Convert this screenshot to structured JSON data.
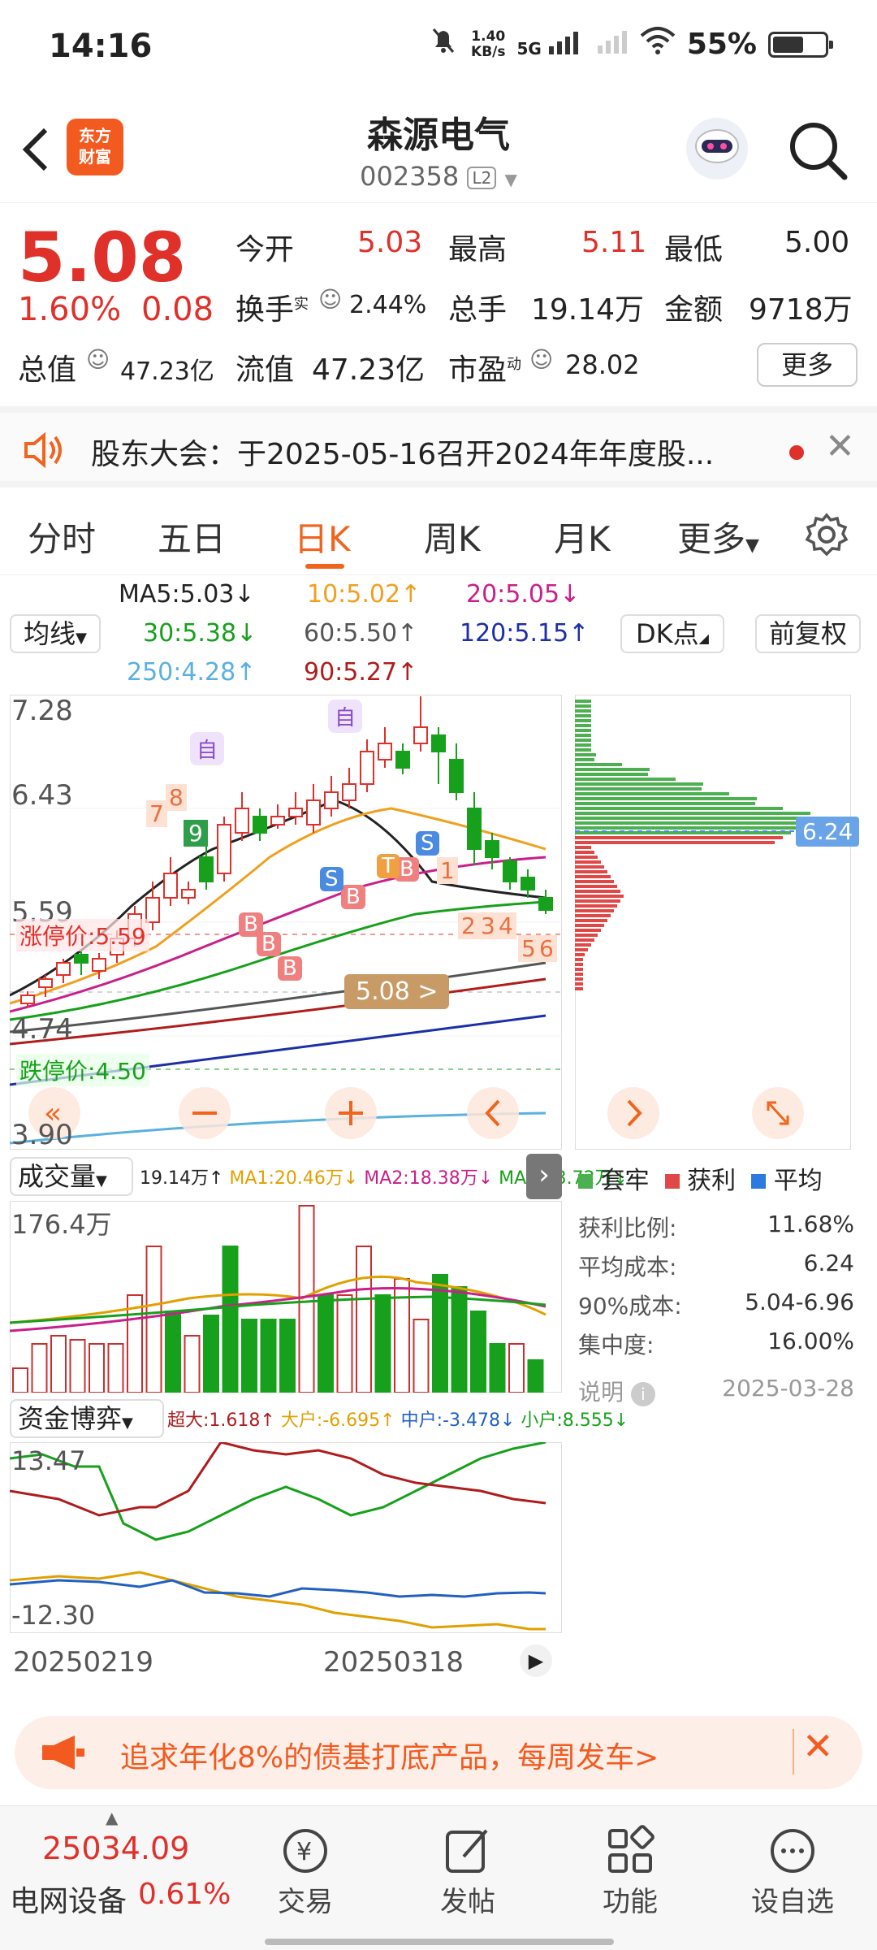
{
  "status": {
    "time": "14:16",
    "speed_value": "1.40",
    "speed_unit": "KB/s",
    "network": "5G",
    "battery": "55%"
  },
  "header": {
    "logo_line1": "东方",
    "logo_line2": "财富",
    "name": "森源电气",
    "code": "002358",
    "level": "L2"
  },
  "quote": {
    "price": "5.08",
    "change_pct": "1.60%",
    "change": "0.08",
    "open_label": "今开",
    "open": "5.03",
    "high_label": "最高",
    "high": "5.11",
    "low_label": "最低",
    "low": "5.00",
    "turnover_label": "换手",
    "turnover_sup": "实",
    "turnover": "2.44%",
    "volume_label": "总手",
    "volume": "19.14万",
    "amount_label": "金额",
    "amount": "9718万",
    "mcap_label": "总值",
    "mcap": "47.23亿",
    "float_label": "流值",
    "float": "47.23亿",
    "pe_label": "市盈",
    "pe_sup": "动",
    "pe": "28.02",
    "more": "更多"
  },
  "notice": {
    "text": "股东大会：于2025-05-16召开2024年年度股..."
  },
  "tabs": [
    "分时",
    "五日",
    "日K",
    "周K",
    "月K",
    "更多"
  ],
  "ma": {
    "mode": "均线",
    "ma5": "MA5:5.03↓",
    "ma10": "10:5.02↑",
    "ma20": "20:5.05↓",
    "ma30": "30:5.38↓",
    "ma60": "60:5.50↑",
    "ma120": "120:5.15↑",
    "ma250": "250:4.28↑",
    "ma90": "90:5.27↑",
    "dk": "DK点",
    "adjust": "前复权"
  },
  "kchart": {
    "y_top": "7.28",
    "y_mid": "6.43",
    "y_low": "5.59",
    "y_bottom": "4.74",
    "y_min": "3.90",
    "limit_up": "涨停价:5.59",
    "limit_down": "跌停价:4.50",
    "current": "5.08 >",
    "marks": [
      "自",
      "自",
      "7",
      "8",
      "9",
      "1",
      "2",
      "3",
      "4",
      "5",
      "6",
      "B",
      "S",
      "T"
    ]
  },
  "chip": {
    "avg_cost_tag": "6.24",
    "legend": [
      "套牢",
      "获利",
      "平均"
    ],
    "profit_ratio_label": "获利比例:",
    "profit_ratio": "11.68%",
    "avg_cost_label": "平均成本:",
    "avg_cost": "6.24",
    "cost90_label": "90%成本:",
    "cost90": "5.04-6.96",
    "concentration_label": "集中度:",
    "concentration": "16.00%",
    "note": "说明",
    "date": "2025-03-28"
  },
  "volume": {
    "mode": "成交量",
    "vol": "19.14万↑",
    "ma1": "MA1:20.46万↓",
    "ma2": "MA2:18.38万↓",
    "ma3": "MA3:23.72万↓",
    "y_top": "176.4万"
  },
  "fund": {
    "mode": "资金博弈",
    "super": "超大:1.618↑",
    "big": "大户:-6.695↑",
    "mid": "中户:-3.478↓",
    "small": "小户:8.555↓",
    "y_top": "13.47",
    "y_bottom": "-12.30",
    "date1": "20250219",
    "date2": "20250318"
  },
  "ad": {
    "text": "追求年化8%的债基打底产品，每周发车>"
  },
  "bottom": {
    "index_value": "25034.09",
    "index_name": "电网设备",
    "index_pct": "0.61%",
    "nav": [
      "交易",
      "发帖",
      "功能",
      "设自选"
    ]
  },
  "chart_data": {
    "type": "bar",
    "title": "",
    "xlabel": "",
    "ylabel": "",
    "categories": [
      "20250219",
      "20250318"
    ],
    "series": [
      {
        "name": "MA5",
        "values": [
          5.03
        ]
      },
      {
        "name": "10",
        "values": [
          5.02
        ]
      },
      {
        "name": "20",
        "values": [
          5.05
        ]
      },
      {
        "name": "30",
        "values": [
          5.38
        ]
      },
      {
        "name": "60",
        "values": [
          5.5
        ]
      },
      {
        "name": "120",
        "values": [
          5.15
        ]
      },
      {
        "name": "250",
        "values": [
          4.28
        ]
      },
      {
        "name": "90",
        "values": [
          5.27
        ]
      }
    ],
    "ylim": [
      3.9,
      7.28
    ]
  }
}
